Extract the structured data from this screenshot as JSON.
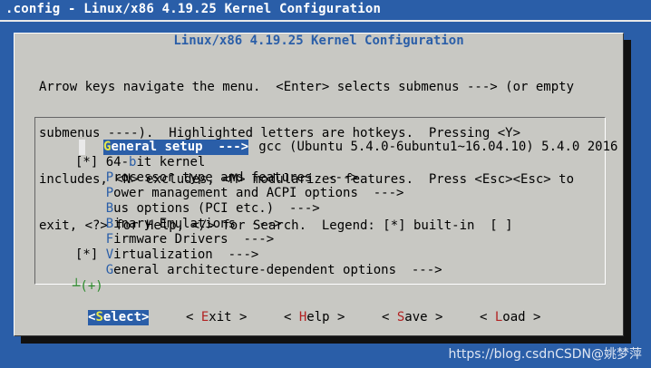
{
  "window": {
    "title": ".config - Linux/x86 4.19.25 Kernel Configuration"
  },
  "dialog": {
    "title": "Linux/x86 4.19.25 Kernel Configuration",
    "help_lines": [
      "Arrow keys navigate the menu.  <Enter> selects submenus ---> (or empty",
      "submenus ----).  Highlighted letters are hotkeys.  Pressing <Y>",
      "includes, <N> excludes, <M> modularizes features.  Press <Esc><Esc> to",
      "exit, <?> for Help, </> for Search.  Legend: [*] built-in  [ ]"
    ]
  },
  "menu": {
    "items": [
      {
        "prefix": "    ",
        "hot": "",
        "text": "*** Compiler: gcc (Ubuntu 5.4.0-6ubuntu1~16.04.10) 5.4.0 2016",
        "selected": false
      },
      {
        "prefix": "    ",
        "hot": "G",
        "text": "eneral setup  --->",
        "selected": true
      },
      {
        "prefix": "[*] ",
        "hot": "",
        "text": "64-bit kernel",
        "selected": false,
        "hot_mid": "b",
        "pre": "64-",
        "post": "it kernel"
      },
      {
        "prefix": "    ",
        "hot": "P",
        "text": "rocessor type and features  --->",
        "selected": false
      },
      {
        "prefix": "    ",
        "hot": "P",
        "text": "ower management and ACPI options  --->",
        "selected": false
      },
      {
        "prefix": "    ",
        "hot": "B",
        "text": "us options (PCI etc.)  --->",
        "selected": false
      },
      {
        "prefix": "    ",
        "hot": "B",
        "text": "inary Emulations  --->",
        "selected": false
      },
      {
        "prefix": "    ",
        "hot": "F",
        "text": "irmware Drivers  --->",
        "selected": false
      },
      {
        "prefix": "[*] ",
        "hot": "V",
        "text": "irtualization  --->",
        "selected": false
      },
      {
        "prefix": "    ",
        "hot": "G",
        "text": "eneral architecture-dependent options  --->",
        "selected": false
      }
    ],
    "more_indicator": "┴(+)"
  },
  "buttons": [
    {
      "id": "select",
      "pre": "<",
      "hot": "S",
      "rest": "elect>",
      "active": true
    },
    {
      "id": "exit",
      "pre": "< ",
      "hot": "E",
      "rest": "xit >",
      "active": false
    },
    {
      "id": "help",
      "pre": "< ",
      "hot": "H",
      "rest": "elp >",
      "active": false
    },
    {
      "id": "save",
      "pre": "< ",
      "hot": "S",
      "rest": "ave >",
      "active": false
    },
    {
      "id": "load",
      "pre": "< ",
      "hot": "L",
      "rest": "oad >",
      "active": false
    }
  ],
  "watermark": "https://blog.csdnCSDN@姚梦萍"
}
